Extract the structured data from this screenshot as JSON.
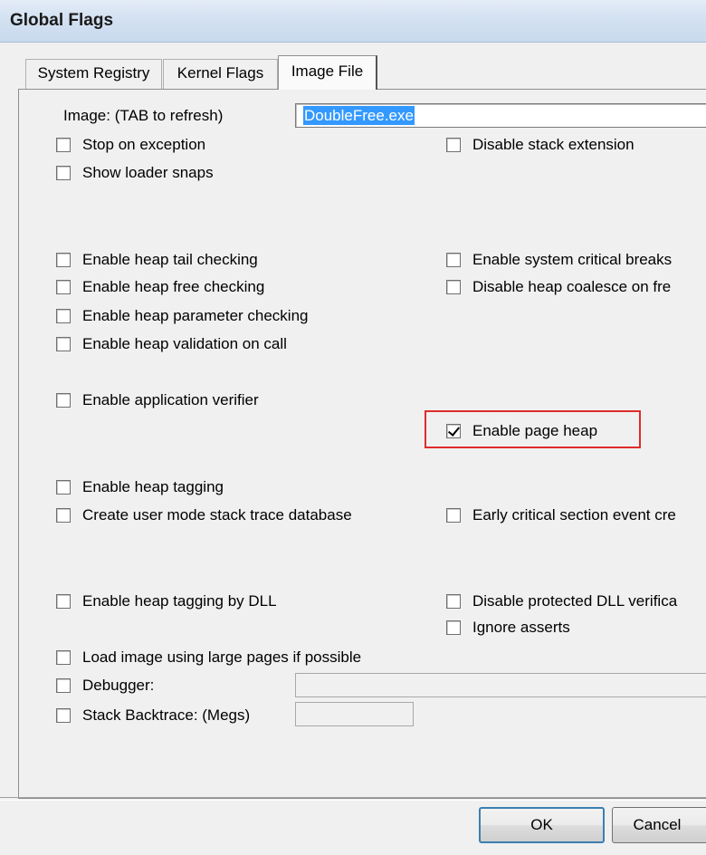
{
  "window": {
    "title": "Global Flags"
  },
  "tabs": [
    {
      "label": "System Registry",
      "active": false
    },
    {
      "label": "Kernel Flags",
      "active": false
    },
    {
      "label": "Image File",
      "active": true
    }
  ],
  "image": {
    "label": "Image: (TAB to refresh)",
    "value": "DoubleFree.exe"
  },
  "checkboxes": {
    "stop_on_exception": {
      "label": "Stop on exception",
      "checked": false
    },
    "show_loader_snaps": {
      "label": "Show loader snaps",
      "checked": false
    },
    "disable_stack_extension": {
      "label": "Disable stack extension",
      "checked": false
    },
    "heap_tail_checking": {
      "label": "Enable heap tail checking",
      "checked": false
    },
    "heap_free_checking": {
      "label": "Enable heap free checking",
      "checked": false
    },
    "heap_parameter_checking": {
      "label": "Enable heap parameter checking",
      "checked": false
    },
    "heap_validation_on_call": {
      "label": "Enable heap validation on call",
      "checked": false
    },
    "system_critical_breaks": {
      "label": "Enable system critical breaks",
      "checked": false
    },
    "disable_heap_coalesce": {
      "label": "Disable heap coalesce on fre",
      "checked": false
    },
    "application_verifier": {
      "label": "Enable application verifier",
      "checked": false
    },
    "page_heap": {
      "label": "Enable page heap",
      "checked": true
    },
    "heap_tagging": {
      "label": "Enable heap tagging",
      "checked": false
    },
    "user_mode_stack_trace": {
      "label": "Create user mode stack trace database",
      "checked": false
    },
    "early_critical_section": {
      "label": "Early critical section event cre",
      "checked": false
    },
    "heap_tagging_by_dll": {
      "label": "Enable heap tagging by DLL",
      "checked": false
    },
    "disable_protected_dll": {
      "label": "Disable protected DLL verifica",
      "checked": false
    },
    "ignore_asserts": {
      "label": "Ignore asserts",
      "checked": false
    },
    "large_pages": {
      "label": "Load image using large pages if possible",
      "checked": false
    },
    "debugger": {
      "label": "Debugger:",
      "checked": false
    },
    "stack_backtrace": {
      "label": "Stack Backtrace: (Megs)",
      "checked": false
    }
  },
  "buttons": {
    "ok": "OK",
    "cancel": "Cancel"
  },
  "colors": {
    "highlight_border": "#e02b2b",
    "selection": "#3399ff"
  }
}
